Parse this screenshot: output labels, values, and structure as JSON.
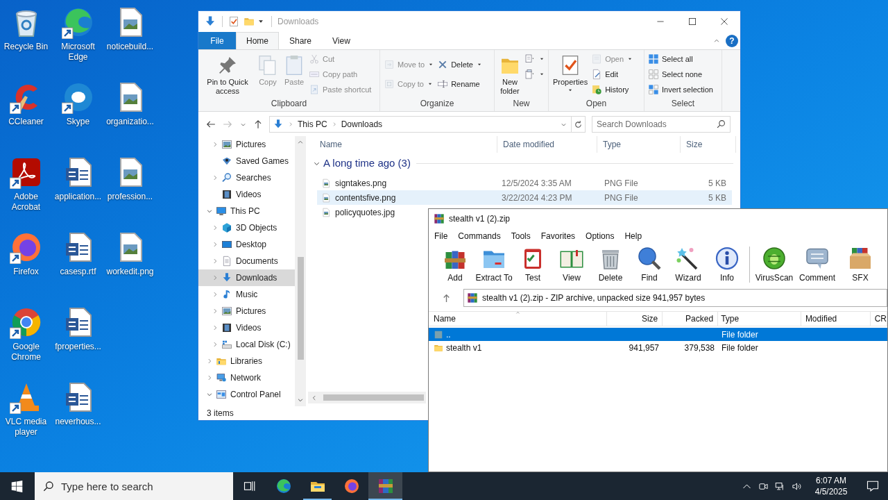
{
  "desktop_columns": [
    {
      "icons": [
        {
          "label": "Recycle Bin",
          "kind": "recycle",
          "shortcut": false
        },
        {
          "label": "CCleaner",
          "kind": "ccleaner",
          "shortcut": true
        },
        {
          "label": "Adobe Acrobat",
          "kind": "acrobat",
          "shortcut": true
        },
        {
          "label": "Firefox",
          "kind": "firefox",
          "shortcut": true
        },
        {
          "label": "Google Chrome",
          "kind": "chrome",
          "shortcut": true
        },
        {
          "label": "VLC media player",
          "kind": "vlc",
          "shortcut": true
        }
      ]
    },
    {
      "icons": [
        {
          "label": "Microsoft Edge",
          "kind": "edge",
          "shortcut": true
        },
        {
          "label": "Skype",
          "kind": "skype",
          "shortcut": true
        },
        {
          "label": "application...",
          "kind": "word",
          "shortcut": false
        },
        {
          "label": "casesp.rtf",
          "kind": "word",
          "shortcut": false
        },
        {
          "label": "fproperties...",
          "kind": "word",
          "shortcut": false
        },
        {
          "label": "neverhous...",
          "kind": "word",
          "shortcut": false
        }
      ]
    },
    {
      "icons": [
        {
          "label": "noticebuild...",
          "kind": "image",
          "shortcut": false
        },
        {
          "label": "organizatio...",
          "kind": "image",
          "shortcut": false
        },
        {
          "label": "profession...",
          "kind": "image",
          "shortcut": false
        },
        {
          "label": "workedit.png",
          "kind": "image",
          "shortcut": false
        }
      ]
    }
  ],
  "explorer": {
    "title": "Downloads",
    "tabs": [
      {
        "label": "File",
        "kind": "file",
        "selected": false
      },
      {
        "label": "Home",
        "kind": "tab",
        "selected": true
      },
      {
        "label": "Share",
        "kind": "tab",
        "selected": false
      },
      {
        "label": "View",
        "kind": "tab",
        "selected": false
      }
    ],
    "help": "?",
    "ribbon": [
      {
        "label": "Clipboard",
        "buttons": [
          {
            "label": "Pin to Quick access",
            "kind": "pin",
            "disabled": false,
            "dropdown": false
          },
          {
            "label": "Copy",
            "kind": "copy",
            "disabled": true,
            "dropdown": false
          },
          {
            "label": "Paste",
            "kind": "paste",
            "disabled": true,
            "dropdown": false
          }
        ],
        "stacks": [
          [
            {
              "label": "Cut",
              "kind": "cut",
              "disabled": true,
              "dropdown": false
            },
            {
              "label": "Copy path",
              "kind": "copypath",
              "disabled": true,
              "dropdown": false
            },
            {
              "label": "Paste shortcut",
              "kind": "pasteshortcut",
              "disabled": true,
              "dropdown": false
            }
          ]
        ]
      },
      {
        "label": "Organize",
        "stacks": [
          [
            {
              "label": "Move to",
              "kind": "moveto",
              "disabled": true,
              "dropdown": true
            },
            {
              "label": "Copy to",
              "kind": "copyto",
              "disabled": true,
              "dropdown": true
            }
          ],
          [
            {
              "label": "Delete",
              "kind": "delete",
              "disabled": false,
              "dropdown": true
            },
            {
              "label": "Rename",
              "kind": "rename",
              "disabled": false,
              "dropdown": false
            }
          ]
        ]
      },
      {
        "label": "New",
        "buttons": [
          {
            "label": "New folder",
            "kind": "newfolder",
            "disabled": false,
            "dropdown": false
          }
        ],
        "stacks": [
          [
            {
              "kind": "newitem",
              "disabled": false,
              "dropdown": true
            },
            {
              "kind": "easyaccess",
              "disabled": false,
              "dropdown": true
            }
          ]
        ]
      },
      {
        "label": "Open",
        "buttons": [
          {
            "label": "Properties",
            "kind": "properties",
            "disabled": false,
            "dropdown": true
          }
        ],
        "stacks": [
          [
            {
              "label": "Open",
              "kind": "open",
              "disabled": true,
              "dropdown": true
            },
            {
              "label": "Edit",
              "kind": "edit",
              "disabled": false,
              "dropdown": false
            },
            {
              "label": "History",
              "kind": "history",
              "disabled": false,
              "dropdown": false
            }
          ]
        ]
      },
      {
        "label": "Select",
        "stacks": [
          [
            {
              "label": "Select all",
              "kind": "selectall",
              "disabled": false,
              "dropdown": false
            },
            {
              "label": "Select none",
              "kind": "selectnone",
              "disabled": false,
              "dropdown": false
            },
            {
              "label": "Invert selection",
              "kind": "invert",
              "disabled": false,
              "dropdown": false
            }
          ]
        ]
      }
    ],
    "address": {
      "crumbs": [
        "This PC",
        "Downloads"
      ]
    },
    "search": {
      "placeholder": "Search Downloads"
    },
    "nav_tree": [
      {
        "children": [
          {
            "label": "Pictures",
            "kind": "pictures",
            "expanded": false,
            "selected": false
          },
          {
            "label": "Saved Games",
            "kind": "games",
            "selected": false
          },
          {
            "label": "Searches",
            "kind": "searches",
            "expanded": false,
            "selected": false
          },
          {
            "label": "Videos",
            "kind": "videos",
            "selected": false
          }
        ]
      },
      {
        "label": "This PC",
        "kind": "pc",
        "expanded": true,
        "selected": false,
        "children": [
          {
            "label": "3D Objects",
            "kind": "cube",
            "expanded": false,
            "selected": false
          },
          {
            "label": "Desktop",
            "kind": "desktop",
            "expanded": false,
            "selected": false
          },
          {
            "label": "Documents",
            "kind": "documents",
            "expanded": false,
            "selected": false
          },
          {
            "label": "Downloads",
            "kind": "downloads",
            "expanded": false,
            "selected": true
          },
          {
            "label": "Music",
            "kind": "music",
            "expanded": false,
            "selected": false
          },
          {
            "label": "Pictures",
            "kind": "pictures",
            "expanded": false,
            "selected": false
          },
          {
            "label": "Videos",
            "kind": "videos",
            "expanded": false,
            "selected": false
          },
          {
            "label": "Local Disk (C:)",
            "kind": "disk",
            "expanded": false,
            "selected": false
          }
        ]
      },
      {
        "label": "Libraries",
        "kind": "libraries",
        "expanded": false,
        "selected": false
      },
      {
        "label": "Network",
        "kind": "network",
        "expanded": false,
        "selected": false
      },
      {
        "label": "Control Panel",
        "kind": "controlpanel",
        "expanded": true,
        "selected": false
      }
    ],
    "columns": [
      "Name",
      "Date modified",
      "Type",
      "Size"
    ],
    "group": {
      "label": "A long time ago (3)",
      "expanded": true
    },
    "files": [
      {
        "name": "signtakes.png",
        "date": "12/5/2024 3:35 AM",
        "type": "PNG File",
        "size": "5 KB",
        "selected": false
      },
      {
        "name": "contentsfive.png",
        "date": "3/22/2024 4:23 PM",
        "type": "PNG File",
        "size": "5 KB",
        "selected": true
      },
      {
        "name": "policyquotes.jpg",
        "selected": false
      }
    ],
    "status": "3 items"
  },
  "winrar": {
    "title": "stealth v1 (2).zip",
    "menu": [
      "File",
      "Commands",
      "Tools",
      "Favorites",
      "Options",
      "Help"
    ],
    "toolbar_groups": [
      [
        {
          "label": "Add",
          "kind": "add"
        },
        {
          "label": "Extract To",
          "kind": "extract"
        },
        {
          "label": "Test",
          "kind": "test"
        },
        {
          "label": "View",
          "kind": "view"
        },
        {
          "label": "Delete",
          "kind": "trash"
        },
        {
          "label": "Find",
          "kind": "find"
        },
        {
          "label": "Wizard",
          "kind": "wizard"
        },
        {
          "label": "Info",
          "kind": "info"
        }
      ],
      [
        {
          "label": "VirusScan",
          "kind": "virus"
        },
        {
          "label": "Comment",
          "kind": "comment"
        },
        {
          "label": "SFX",
          "kind": "sfx"
        }
      ]
    ],
    "path": "stealth v1 (2).zip - ZIP archive, unpacked size 941,957 bytes",
    "columns": [
      {
        "label": "Name",
        "sorted": true
      },
      {
        "label": "Size",
        "sorted": false
      },
      {
        "label": "Packed",
        "sorted": false
      },
      {
        "label": "Type",
        "sorted": false
      },
      {
        "label": "Modified",
        "sorted": false
      },
      {
        "label": "CR",
        "sorted": false
      }
    ],
    "rows": [
      {
        "name": "..",
        "kind": "parent",
        "type": "File folder",
        "selected": true
      },
      {
        "name": "stealth v1",
        "kind": "folder",
        "size": "941,957",
        "packed": "379,538",
        "type": "File folder",
        "selected": false
      }
    ]
  },
  "taskbar": {
    "search": {
      "placeholder": "Type here to search"
    },
    "apps": [
      {
        "kind": "edge",
        "running": false,
        "selected": false
      },
      {
        "kind": "explorer",
        "running": true,
        "selected": false
      },
      {
        "kind": "firefox",
        "running": false,
        "selected": false
      },
      {
        "kind": "winrar",
        "running": true,
        "selected": true
      }
    ],
    "time": "6:07 AM",
    "date": "4/5/2025"
  }
}
